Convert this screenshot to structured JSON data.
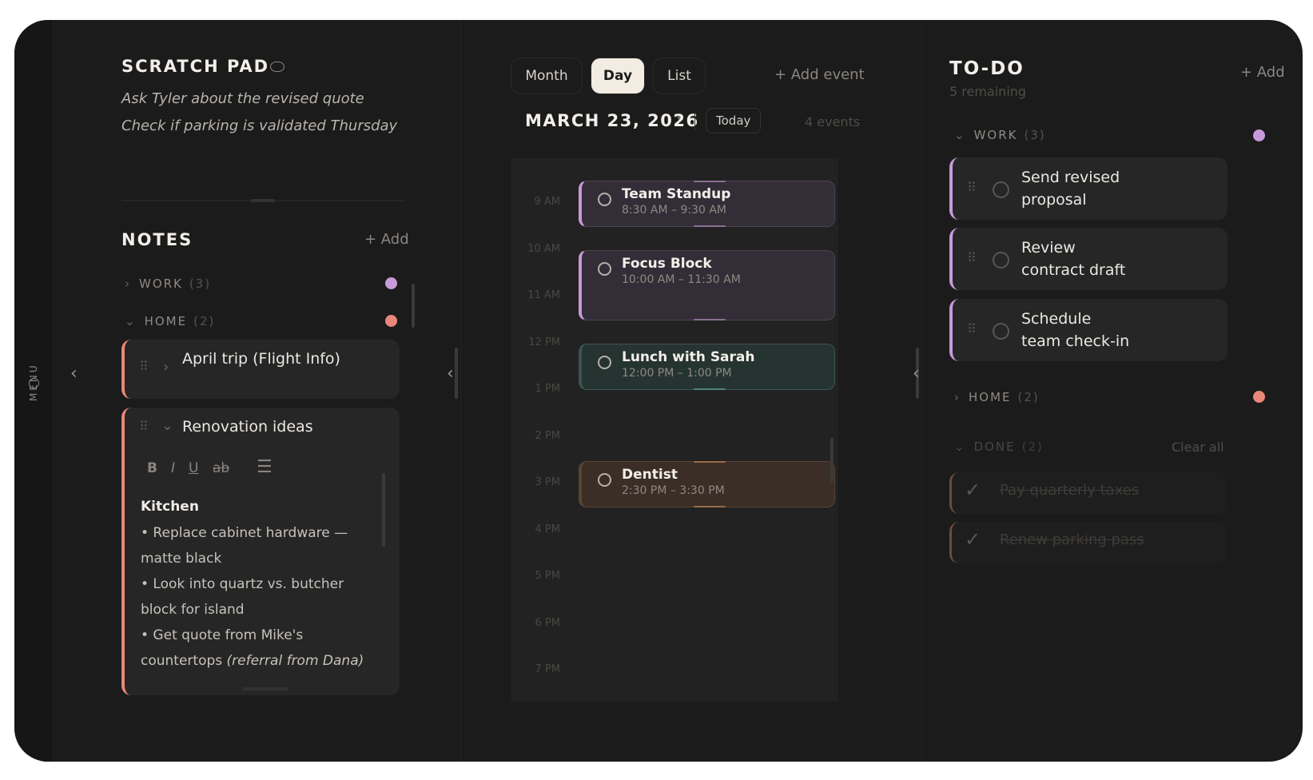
{
  "menu": {
    "label": "MENU"
  },
  "scratch": {
    "title": "SCRATCH PAD",
    "lines": [
      "Ask Tyler about the revised quote",
      "Check if parking is validated Thursday"
    ]
  },
  "notes": {
    "title": "NOTES",
    "add": "+ Add",
    "groups": [
      {
        "label": "WORK",
        "count": "(3)",
        "color": "#c79ad9"
      },
      {
        "label": "HOME",
        "count": "(2)",
        "color": "#e8877a"
      }
    ],
    "items": [
      {
        "title": "April trip (Flight Info)"
      },
      {
        "title": "Renovation ideas",
        "heading": "Kitchen",
        "body1": "• Replace cabinet hardware —",
        "body2": "matte black",
        "body3": "• Look into quartz vs. butcher",
        "body4": "block for island",
        "body5": "• Get quote from Mike's",
        "body6a": "countertops ",
        "body6b": "(referral from Dana)"
      }
    ],
    "format": {
      "bold": "B",
      "italic": "I",
      "underline": "U",
      "strike": "ab"
    }
  },
  "calendar": {
    "tabs": [
      "Month",
      "Day",
      "List"
    ],
    "active_tab": "Day",
    "add_event": "+ Add event",
    "date": "MARCH 23, 2026",
    "today": "Today",
    "events_count": "4 events",
    "hours": [
      "9 AM",
      "10 AM",
      "11 AM",
      "12 PM",
      "1 PM",
      "2 PM",
      "3 PM",
      "4 PM",
      "5 PM",
      "6 PM",
      "7 PM"
    ],
    "events": [
      {
        "title": "Team Standup",
        "time": "8:30 AM – 9:30 AM",
        "color": "#c79ad9"
      },
      {
        "title": "Focus Block",
        "time": "10:00 AM – 11:30 AM",
        "color": "#c79ad9"
      },
      {
        "title": "Lunch with Sarah",
        "time": "12:00 PM – 1:00 PM",
        "color": "#6fb7b0"
      },
      {
        "title": "Dentist",
        "time": "2:30 PM – 3:30 PM",
        "color": "#e3a36f"
      }
    ]
  },
  "todo": {
    "title": "TO-DO",
    "remaining": "5 remaining",
    "add": "+ Add",
    "work": {
      "label": "WORK",
      "count": "(3)",
      "color": "#c79ad9"
    },
    "home": {
      "label": "HOME",
      "count": "(2)",
      "color": "#e8877a"
    },
    "done": {
      "label": "DONE",
      "count": "(2)",
      "clear": "Clear all"
    },
    "work_items": [
      {
        "line1": "Send revised",
        "line2": "proposal"
      },
      {
        "line1": "Review",
        "line2": "contract draft"
      },
      {
        "line1": "Schedule",
        "line2": "team check-in"
      }
    ],
    "done_items": [
      "Pay quarterly taxes",
      "Renew parking pass"
    ]
  }
}
